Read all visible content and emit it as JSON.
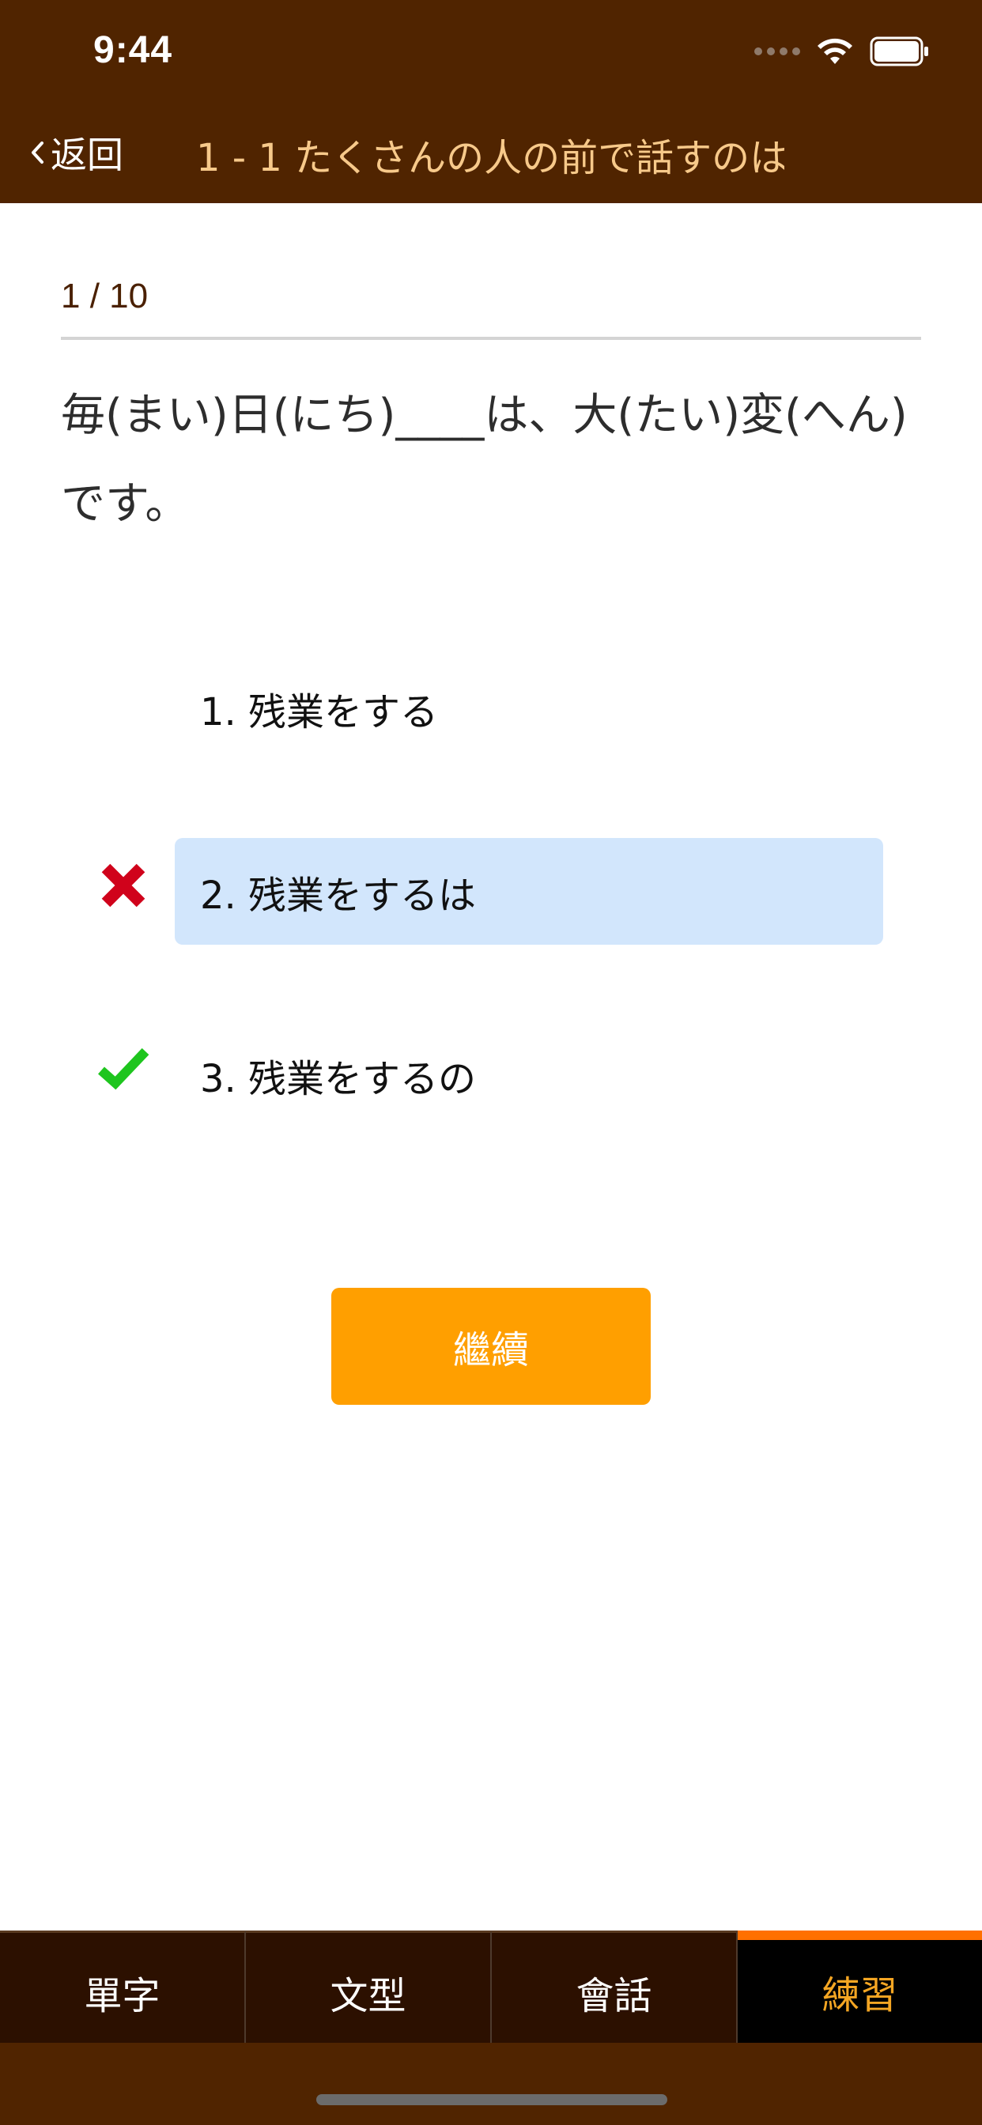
{
  "status_bar": {
    "time": "9:44",
    "icons": [
      "cellular-dots-icon",
      "wifi-icon",
      "battery-icon"
    ]
  },
  "nav": {
    "back_label": "返回",
    "title": "1 - 1 たくさんの人の前で話すのは"
  },
  "quiz": {
    "progress": "1 / 10",
    "question": "毎(まい)日(にち)____は、大(たい)変(へん)です。",
    "options": [
      {
        "label": "1. 残業をする",
        "state": "none"
      },
      {
        "label": "2. 残業をするは",
        "state": "selected-wrong"
      },
      {
        "label": "3. 残業をするの",
        "state": "correct"
      }
    ],
    "continue_label": "繼續"
  },
  "tabs": [
    {
      "label": "單字",
      "active": false
    },
    {
      "label": "文型",
      "active": false
    },
    {
      "label": "會話",
      "active": false
    },
    {
      "label": "練習",
      "active": true
    }
  ],
  "colors": {
    "header_bg": "#502400",
    "title_text": "#f7c98a",
    "selected_option_bg": "#d2e6fc",
    "wrong_mark": "#d0021b",
    "correct_mark": "#1ec51e",
    "continue_bg": "#ff9f00",
    "active_tab_text": "#f5a623",
    "active_tab_indicator": "#ff7000"
  }
}
